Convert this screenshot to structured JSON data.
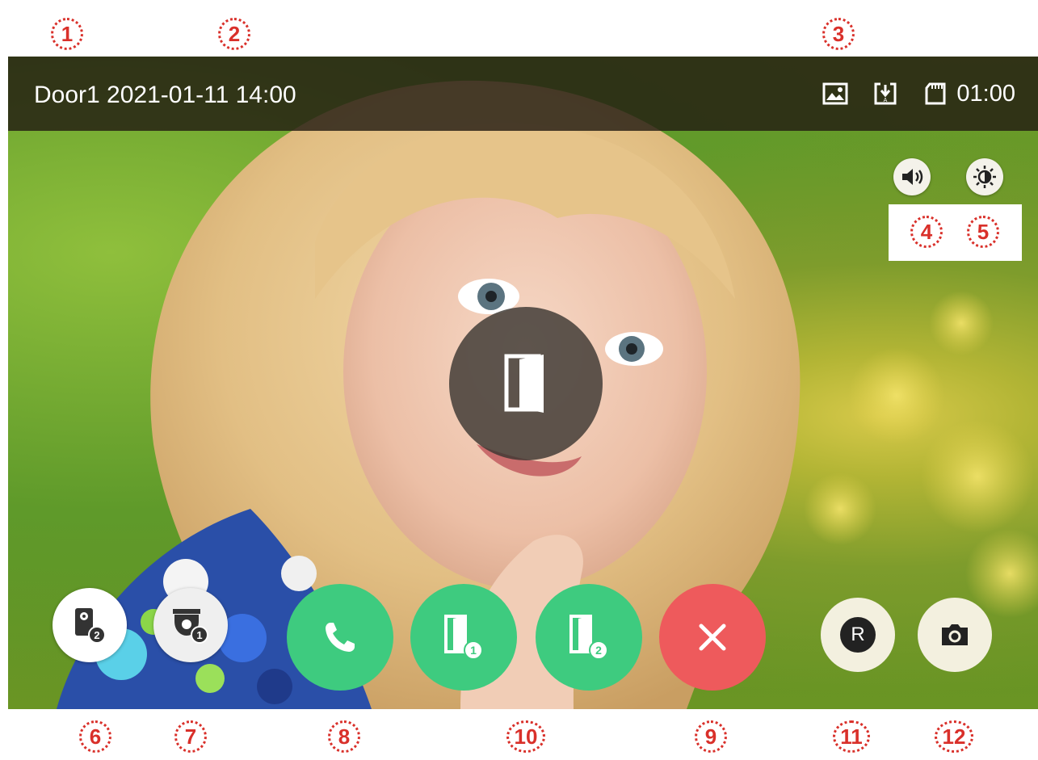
{
  "callouts": {
    "c1": "1",
    "c2": "2",
    "c3": "3",
    "c4": "4",
    "c5": "5",
    "c6": "6",
    "c7": "7",
    "c8": "8",
    "c9": "9",
    "c10": "10",
    "c11": "11",
    "c12": "12"
  },
  "topbar": {
    "door_label": "Door1 2021-01-11 14:00",
    "timer": "01:00",
    "icons": [
      "image-icon",
      "download-icon",
      "sd-card-icon"
    ]
  },
  "controls": {
    "volume": "speaker-icon",
    "brightness": "brightness-icon",
    "center": "door-open-icon",
    "switch_door": "door-station-2-icon",
    "switch_camera": "camera-1-icon",
    "answer": "phone-icon",
    "unlock_1": "unlock-door-1-icon",
    "unlock_2": "unlock-door-2-icon",
    "hangup": "close-icon",
    "record": "R",
    "snapshot": "camera-icon"
  },
  "colors": {
    "green": "#3ecb7f",
    "red": "#ee5a5c",
    "callout": "#d9302a"
  }
}
